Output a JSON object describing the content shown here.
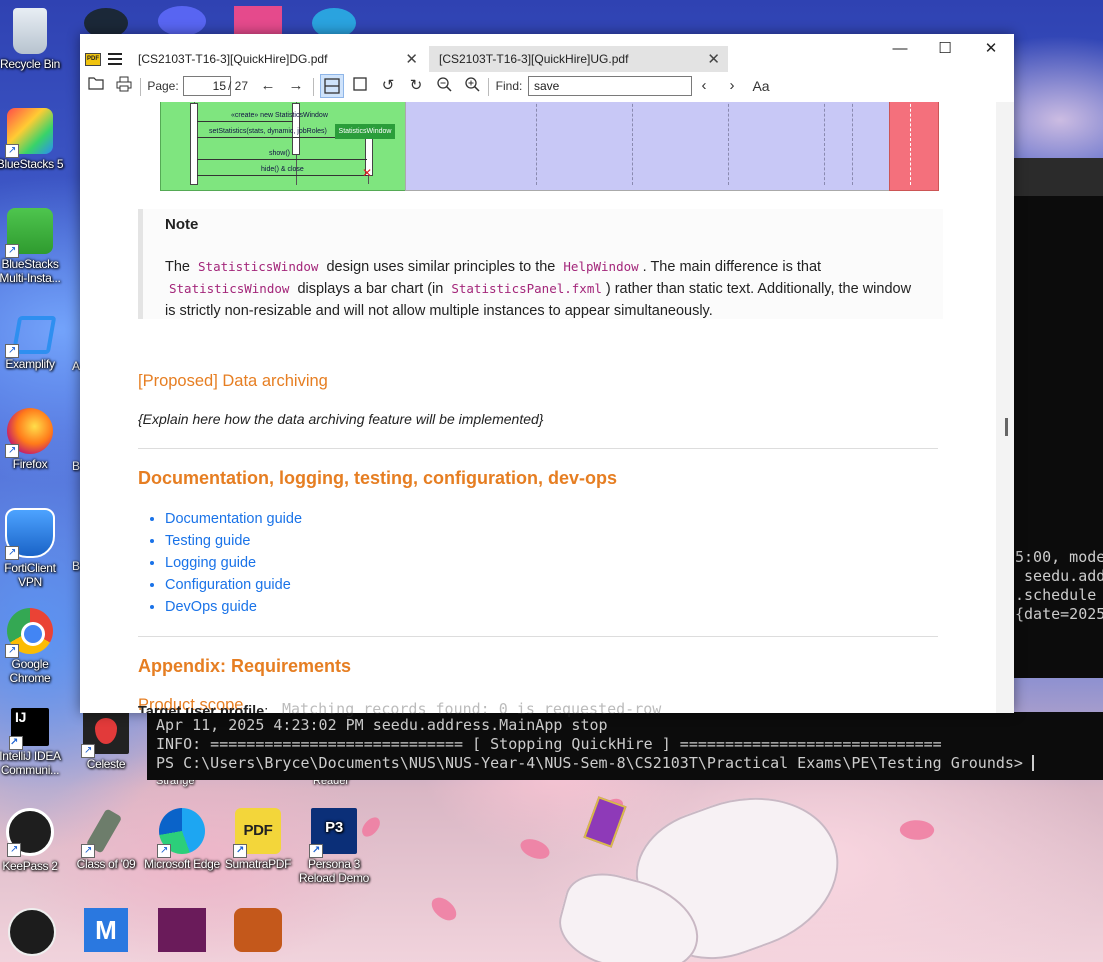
{
  "desktop": {
    "icons": [
      {
        "label": "Recycle Bin"
      },
      {
        "label": "BlueStacks 5"
      },
      {
        "label": "BlueStacks Multi-Insta..."
      },
      {
        "label": "Examplify"
      },
      {
        "label": "Firefox"
      },
      {
        "label": "FortiClient VPN"
      },
      {
        "label": "Google Chrome"
      },
      {
        "label": "IntelliJ IDEA Communi..."
      },
      {
        "label": "Celeste"
      },
      {
        "label": "KeePass 2"
      },
      {
        "label": "Class of '09"
      },
      {
        "label": "Microsoft Edge"
      },
      {
        "label": "SumatraPDF"
      },
      {
        "label": "Persona 3 Reload Demo"
      }
    ],
    "partial_labels": [
      "A",
      "B",
      "B",
      "Strange",
      "Reader"
    ]
  },
  "terminal": {
    "right_lines": [
      "5:00, mode",
      " seedu.add",
      ".schedule",
      "{date=2025"
    ],
    "overlap_line": "Matching records found: 0 is requested-row",
    "lines": [
      "Apr 11, 2025 4:23:02 PM seedu.address.MainApp stop",
      "INFO: ============================ [ Stopping QuickHire ] =============================",
      "PS C:\\Users\\Bryce\\Documents\\NUS\\NUS-Year-4\\NUS-Sem-8\\CS2103T\\Practical Exams\\PE\\Testing Grounds> "
    ]
  },
  "viewer": {
    "logo_text": "PDF",
    "tabs": [
      {
        "title": "[CS2103T-T16-3][QuickHire]DG.pdf",
        "active": true
      },
      {
        "title": "[CS2103T-T16-3][QuickHire]UG.pdf",
        "active": false
      }
    ],
    "window_controls": {
      "minimize": "—",
      "maximize": "☐",
      "close": "✕"
    },
    "toolbar": {
      "page_label": "Page:",
      "page_current": "15",
      "page_total": "/ 27",
      "find_label": "Find:",
      "find_value": "save",
      "font_icon_text": "Aa"
    },
    "diagram": {
      "messages": [
        "«create» new StatisticsWindow",
        "setStatistics(stats, dynamic, jobRoles)",
        "show()",
        "hide() & close"
      ],
      "box_label": "StatisticsWindow"
    },
    "document": {
      "note_title": "Note",
      "note_text": {
        "p1": "The ",
        "c1": "StatisticsWindow",
        "p2": " design uses similar principles to the ",
        "c2": "HelpWindow",
        "p3": ". The main difference is that ",
        "c3": "StatisticsWindow",
        "p4": " displays a bar chart (in ",
        "c4": "StatisticsPanel.fxml",
        "p5": ") rather than static text. Additionally, the window is strictly non-resizable and will not allow multiple instances to appear simultaneously."
      },
      "proposed_heading": "[Proposed] Data archiving",
      "proposed_text": "{Explain here how the data archiving feature will be implemented}",
      "docs_heading": "Documentation, logging, testing, configuration, dev-ops",
      "doc_links": [
        "Documentation guide",
        "Testing guide",
        "Logging guide",
        "Configuration guide",
        "DevOps guide"
      ],
      "appendix_heading": "Appendix: Requirements",
      "scope_heading": "Product scope",
      "profile_label": "Target user profile",
      "profile_suffix": ":"
    }
  }
}
